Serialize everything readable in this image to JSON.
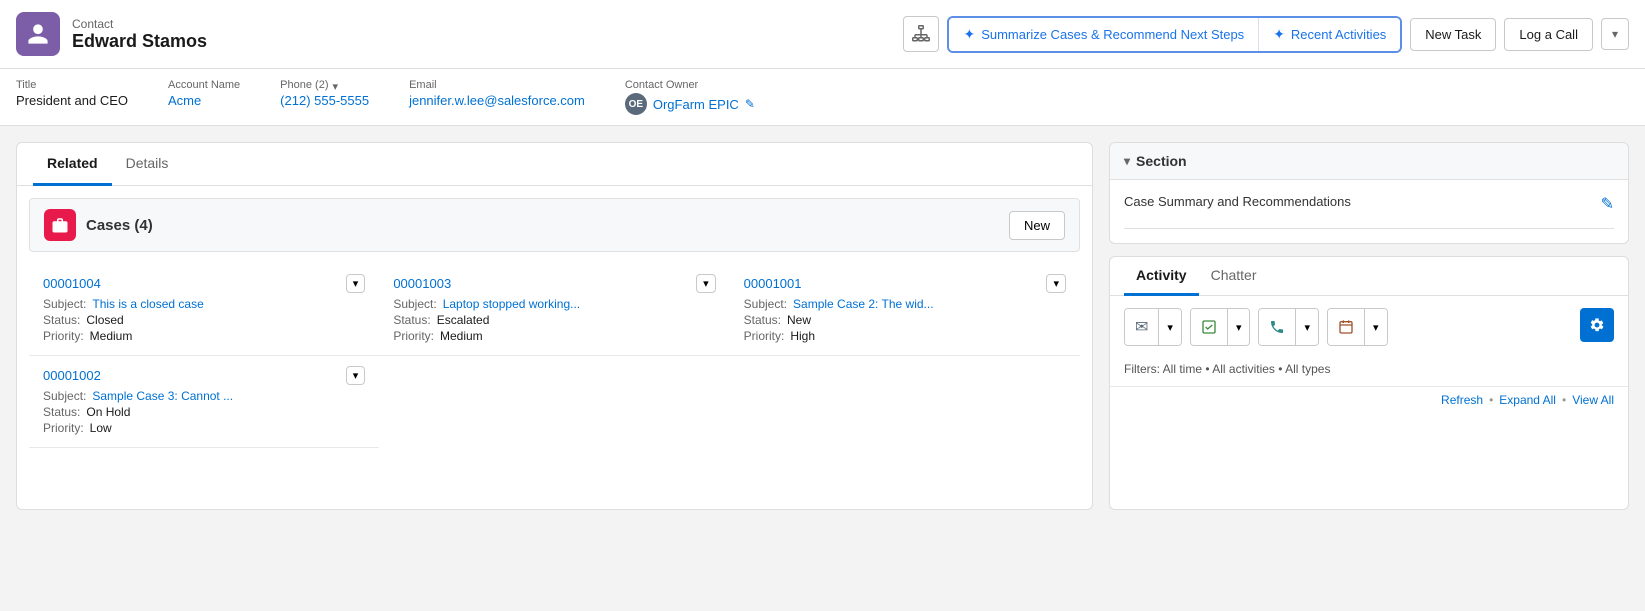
{
  "header": {
    "object_type": "Contact",
    "name": "Edward Stamos",
    "org_btn_icon": "org-chart-icon",
    "ai_buttons": [
      {
        "id": "summarize",
        "label": "Summarize Cases & Recommend Next Steps",
        "icon": "sparkle"
      },
      {
        "id": "recent",
        "label": "Recent Activities",
        "icon": "sparkle"
      }
    ],
    "action_buttons": [
      {
        "id": "new-task",
        "label": "New Task"
      },
      {
        "id": "log-call",
        "label": "Log a Call"
      }
    ],
    "more_dropdown": "▾"
  },
  "fields": {
    "title_label": "Title",
    "title_value": "President and CEO",
    "account_label": "Account Name",
    "account_value": "Acme",
    "phone_label": "Phone (2)",
    "phone_value": "(212) 555-5555",
    "email_label": "Email",
    "email_value": "jennifer.w.lee@salesforce.com",
    "owner_label": "Contact Owner",
    "owner_value": "OrgFarm EPIC",
    "owner_initials": "OE"
  },
  "left_panel": {
    "tabs": [
      {
        "id": "related",
        "label": "Related",
        "active": true
      },
      {
        "id": "details",
        "label": "Details",
        "active": false
      }
    ],
    "cases": {
      "title": "Cases (4)",
      "new_btn": "New",
      "items": [
        {
          "number": "00001004",
          "subject_label": "Subject:",
          "subject_value": "This is a closed case",
          "status_label": "Status:",
          "status_value": "Closed",
          "priority_label": "Priority:",
          "priority_value": "Medium"
        },
        {
          "number": "00001003",
          "subject_label": "Subject:",
          "subject_value": "Laptop stopped working...",
          "status_label": "Status:",
          "status_value": "Escalated",
          "priority_label": "Priority:",
          "priority_value": "Medium"
        },
        {
          "number": "00001001",
          "subject_label": "Subject:",
          "subject_value": "Sample Case 2: The wid...",
          "status_label": "Status:",
          "status_value": "New",
          "priority_label": "Priority:",
          "priority_value": "High"
        },
        {
          "number": "00001002",
          "subject_label": "Subject:",
          "subject_value": "Sample Case 3: Cannot ...",
          "status_label": "Status:",
          "status_value": "On Hold",
          "priority_label": "Priority:",
          "priority_value": "Low"
        }
      ]
    }
  },
  "right_panel": {
    "section": {
      "header": "Section",
      "collapse_icon": "chevron-down",
      "summary_label": "Case Summary and Recommendations",
      "edit_icon": "pencil"
    },
    "activity": {
      "tabs": [
        {
          "id": "activity",
          "label": "Activity",
          "active": true
        },
        {
          "id": "chatter",
          "label": "Chatter",
          "active": false
        }
      ],
      "action_groups": [
        {
          "id": "email-group",
          "actions": [
            {
              "id": "email-btn",
              "icon": "✉",
              "icon_class": "icon-email"
            },
            {
              "id": "email-dropdown",
              "icon": "▾"
            }
          ]
        },
        {
          "id": "task-group",
          "actions": [
            {
              "id": "task-btn",
              "icon": "☑",
              "icon_class": "icon-task"
            },
            {
              "id": "task-dropdown",
              "icon": "▾"
            }
          ]
        },
        {
          "id": "call-group",
          "actions": [
            {
              "id": "call-btn",
              "icon": "☎",
              "icon_class": "icon-call"
            },
            {
              "id": "call-dropdown",
              "icon": "▾"
            }
          ]
        },
        {
          "id": "calendar-group",
          "actions": [
            {
              "id": "calendar-btn",
              "icon": "📅",
              "icon_class": "icon-calendar"
            },
            {
              "id": "calendar-dropdown",
              "icon": "▾"
            }
          ]
        }
      ],
      "filters_text": "Filters: All time • All activities • All types",
      "gear_icon": "gear",
      "bottom_links": [
        {
          "id": "refresh",
          "label": "Refresh"
        },
        {
          "id": "expand-all",
          "label": "Expand All"
        },
        {
          "id": "view-all",
          "label": "View All"
        }
      ]
    }
  }
}
